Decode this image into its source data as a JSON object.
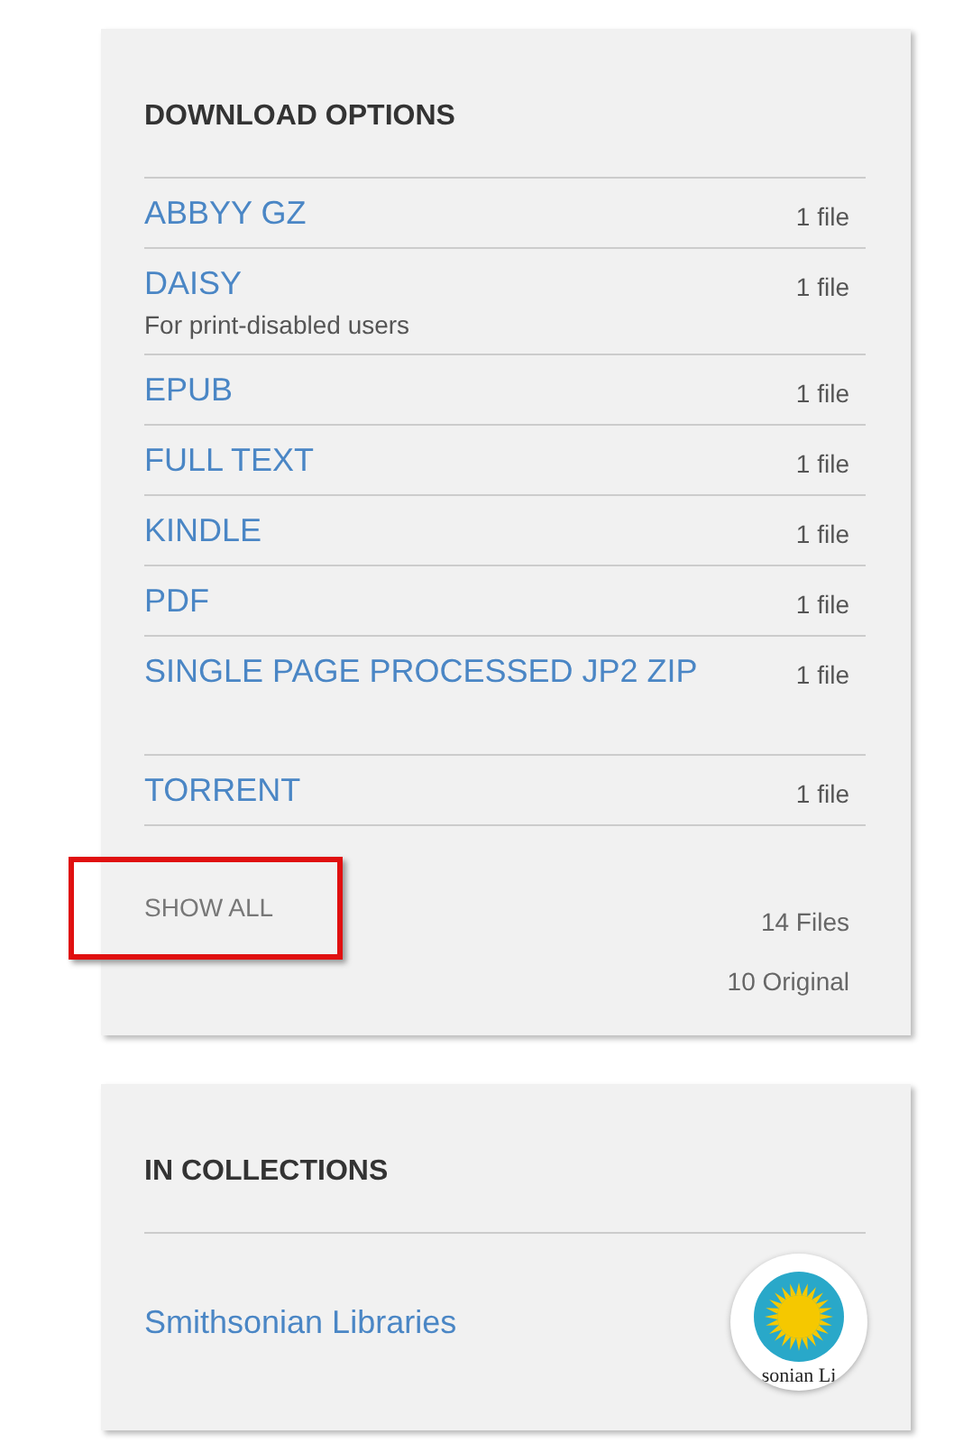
{
  "download_options": {
    "title": "DOWNLOAD OPTIONS",
    "items": [
      {
        "name": "ABBYY GZ",
        "count": "1 file"
      },
      {
        "name": "DAISY",
        "note": "For print-disabled users",
        "count": "1 file"
      },
      {
        "name": "EPUB",
        "count": "1 file"
      },
      {
        "name": "FULL TEXT",
        "count": "1 file"
      },
      {
        "name": "KINDLE",
        "count": "1 file"
      },
      {
        "name": "PDF",
        "count": "1 file"
      },
      {
        "name": "SINGLE PAGE PROCESSED JP2 ZIP",
        "count": "1 file",
        "tall": true
      },
      {
        "name": "TORRENT",
        "count": "1 file"
      }
    ],
    "show_all": {
      "label": "SHOW ALL",
      "highlighted": true
    },
    "totals": [
      "14 Files",
      "10 Original"
    ]
  },
  "collections": {
    "title": "IN COLLECTIONS",
    "items": [
      {
        "name": "Smithsonian Libraries",
        "logo_text": "sonian Li"
      }
    ]
  }
}
